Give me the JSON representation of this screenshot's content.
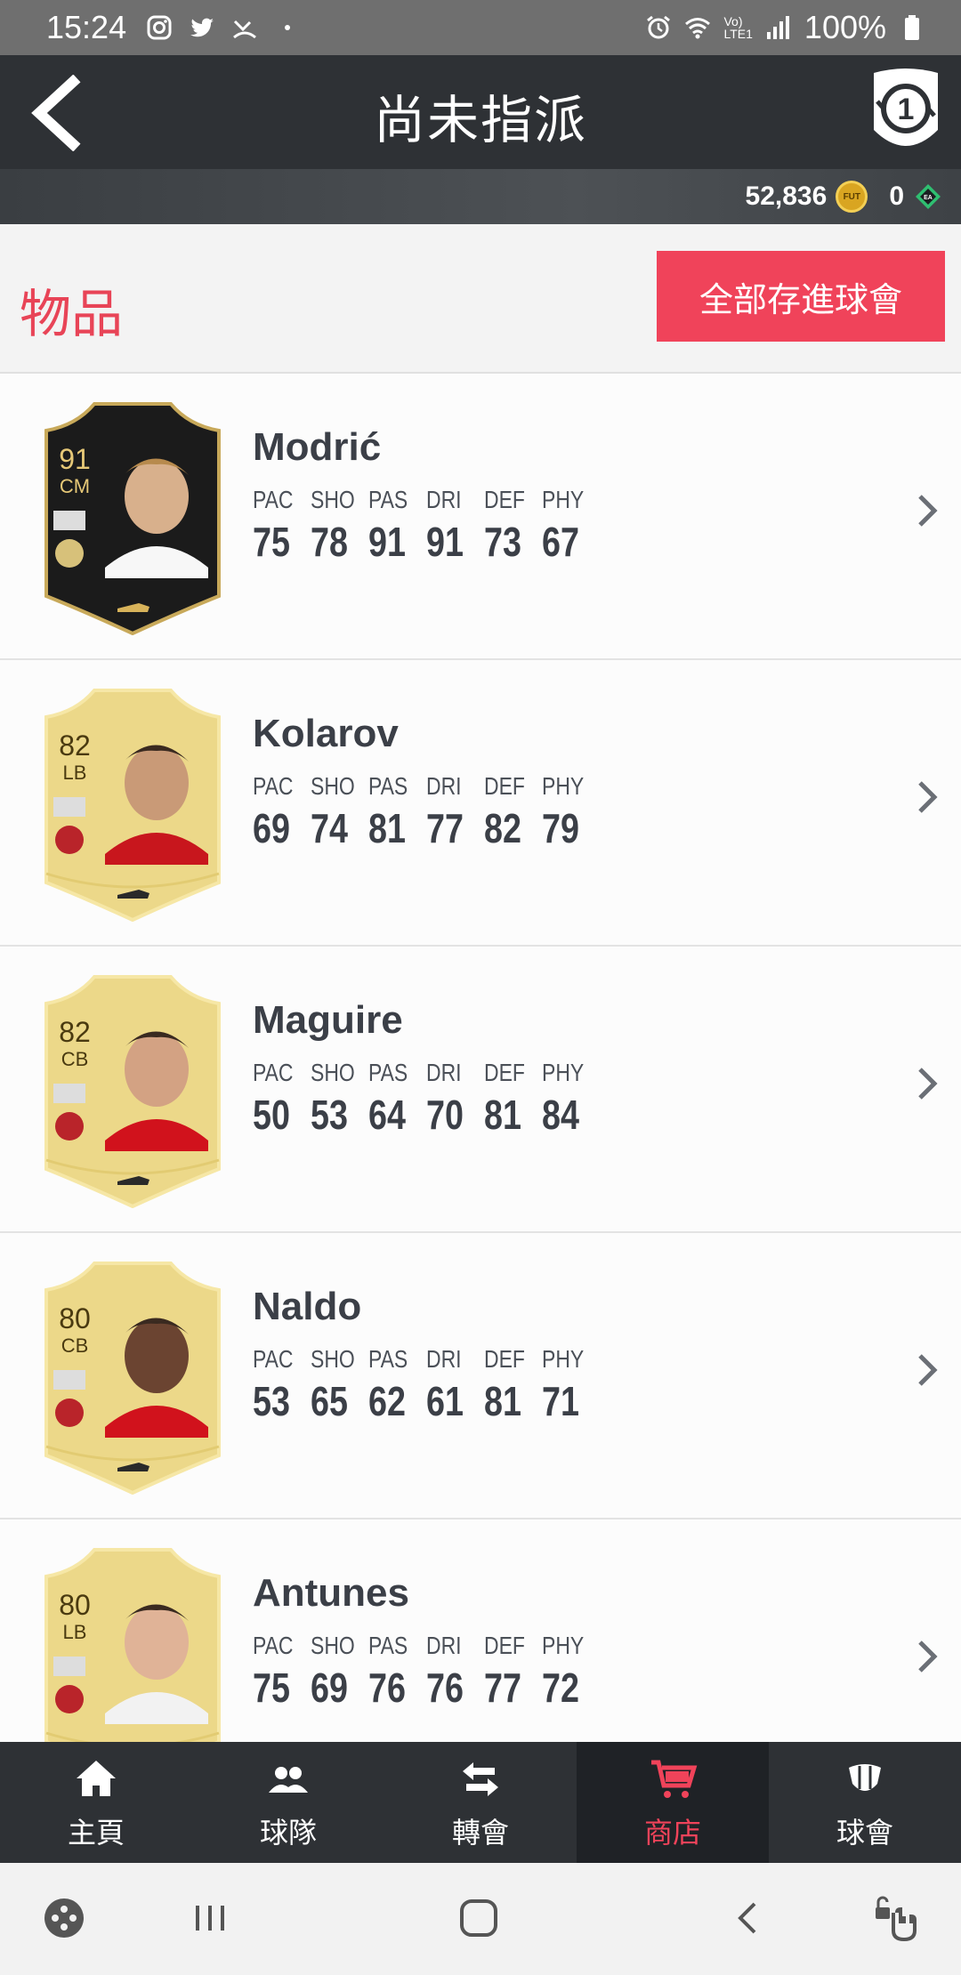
{
  "status_bar": {
    "time": "15:24",
    "battery": "100%",
    "lte_label_top": "Vo)",
    "lte_label_bottom": "LTE1"
  },
  "header": {
    "title": "尚未指派",
    "shield_number": "1"
  },
  "currency": {
    "coins": "52,836",
    "coin_label": "FUT",
    "points": "0",
    "points_icon_label": "EA"
  },
  "items_section": {
    "label": "物品",
    "store_all_button": "全部存進球會"
  },
  "players": [
    {
      "name": "Modrić",
      "rating": "91",
      "position": "CM",
      "card_type": "special",
      "stats": [
        {
          "k": "PAC",
          "v": "75"
        },
        {
          "k": "SHO",
          "v": "78"
        },
        {
          "k": "PAS",
          "v": "91"
        },
        {
          "k": "DRI",
          "v": "91"
        },
        {
          "k": "DEF",
          "v": "73"
        },
        {
          "k": "PHY",
          "v": "67"
        }
      ]
    },
    {
      "name": "Kolarov",
      "rating": "82",
      "position": "LB",
      "card_type": "gold",
      "stats": [
        {
          "k": "PAC",
          "v": "69"
        },
        {
          "k": "SHO",
          "v": "74"
        },
        {
          "k": "PAS",
          "v": "81"
        },
        {
          "k": "DRI",
          "v": "77"
        },
        {
          "k": "DEF",
          "v": "82"
        },
        {
          "k": "PHY",
          "v": "79"
        }
      ]
    },
    {
      "name": "Maguire",
      "rating": "82",
      "position": "CB",
      "card_type": "gold",
      "stats": [
        {
          "k": "PAC",
          "v": "50"
        },
        {
          "k": "SHO",
          "v": "53"
        },
        {
          "k": "PAS",
          "v": "64"
        },
        {
          "k": "DRI",
          "v": "70"
        },
        {
          "k": "DEF",
          "v": "81"
        },
        {
          "k": "PHY",
          "v": "84"
        }
      ]
    },
    {
      "name": "Naldo",
      "rating": "80",
      "position": "CB",
      "card_type": "gold",
      "stats": [
        {
          "k": "PAC",
          "v": "53"
        },
        {
          "k": "SHO",
          "v": "65"
        },
        {
          "k": "PAS",
          "v": "62"
        },
        {
          "k": "DRI",
          "v": "61"
        },
        {
          "k": "DEF",
          "v": "81"
        },
        {
          "k": "PHY",
          "v": "71"
        }
      ]
    },
    {
      "name": "Antunes",
      "rating": "80",
      "position": "LB",
      "card_type": "gold",
      "stats": [
        {
          "k": "PAC",
          "v": "75"
        },
        {
          "k": "SHO",
          "v": "69"
        },
        {
          "k": "PAS",
          "v": "76"
        },
        {
          "k": "DRI",
          "v": "76"
        },
        {
          "k": "DEF",
          "v": "77"
        },
        {
          "k": "PHY",
          "v": "72"
        }
      ]
    }
  ],
  "bottom_nav": [
    {
      "label": "主頁",
      "icon": "home-icon",
      "active": false
    },
    {
      "label": "球隊",
      "icon": "team-icon",
      "active": false
    },
    {
      "label": "轉會",
      "icon": "transfer-icon",
      "active": false
    },
    {
      "label": "商店",
      "icon": "store-icon",
      "active": true
    },
    {
      "label": "球會",
      "icon": "club-icon",
      "active": false
    }
  ],
  "colors": {
    "accent": "#f0435a",
    "header_bg": "#2e3135",
    "gold_card": "#ecd889",
    "special_card": "#1b1b1b"
  }
}
